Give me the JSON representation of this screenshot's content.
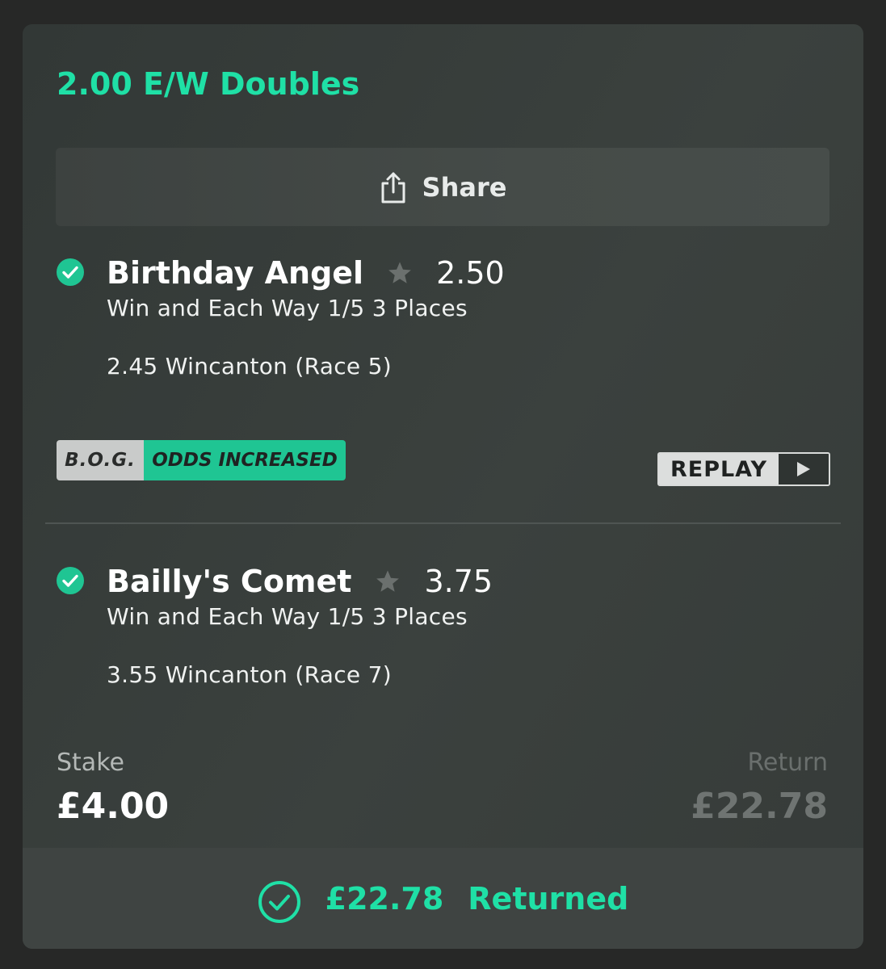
{
  "bet": {
    "title": "2.00 E/W Doubles"
  },
  "share": {
    "label": "Share",
    "icon": "share-icon"
  },
  "selections": [
    {
      "status_icon": "check-circle-icon",
      "name": "Birthday Angel",
      "favourite_icon": "star-icon",
      "odds": "2.50",
      "market": "Win and Each Way 1/5 3 Places",
      "event": "2.45 Wincanton (Race 5)",
      "badges": {
        "bog": "B.O.G.",
        "odds_increased": "ODDS INCREASED"
      },
      "replay": {
        "label": "REPLAY",
        "icon": "play-icon"
      }
    },
    {
      "status_icon": "check-circle-icon",
      "name": "Bailly's Comet",
      "favourite_icon": "star-icon",
      "odds": "3.75",
      "market": "Win and Each Way 1/5 3 Places",
      "event": "3.55 Wincanton (Race 7)"
    }
  ],
  "totals": {
    "stake_label": "Stake",
    "stake_value": "£4.00",
    "return_label": "Return",
    "return_value": "£22.78"
  },
  "footer": {
    "icon": "check-circle-outline-icon",
    "amount": "£22.78",
    "status": "Returned"
  },
  "colors": {
    "accent": "#1fe0a6",
    "badge_green": "#1fc593",
    "background": "#272827"
  }
}
